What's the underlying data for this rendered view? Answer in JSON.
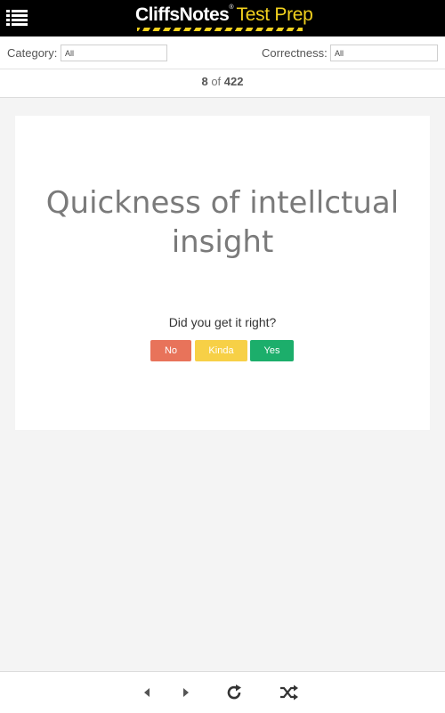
{
  "header": {
    "menu_icon": "hamburger-list-icon",
    "brand_part1": "CliffsNotes",
    "brand_tm": "®",
    "brand_part2": "Test Prep",
    "colors": {
      "background": "#000000",
      "accent": "#f2d11e"
    }
  },
  "filters": {
    "category_label": "Category:",
    "category_value": "All",
    "correctness_label": "Correctness:",
    "correctness_value": "All"
  },
  "counter": {
    "current": "8",
    "of_text": " of ",
    "total": "422"
  },
  "card": {
    "term": "Quickness of intellctual insight",
    "prompt": "Did you get it right?",
    "buttons": {
      "no": {
        "label": "No",
        "color": "#e8735a"
      },
      "kinda": {
        "label": "Kinda",
        "color": "#f7d046"
      },
      "yes": {
        "label": "Yes",
        "color": "#1cae6b"
      }
    }
  },
  "bottom_nav": {
    "prev_icon": "triangle-left-icon",
    "next_icon": "triangle-right-icon",
    "restart_icon": "refresh-icon",
    "shuffle_icon": "shuffle-icon"
  }
}
